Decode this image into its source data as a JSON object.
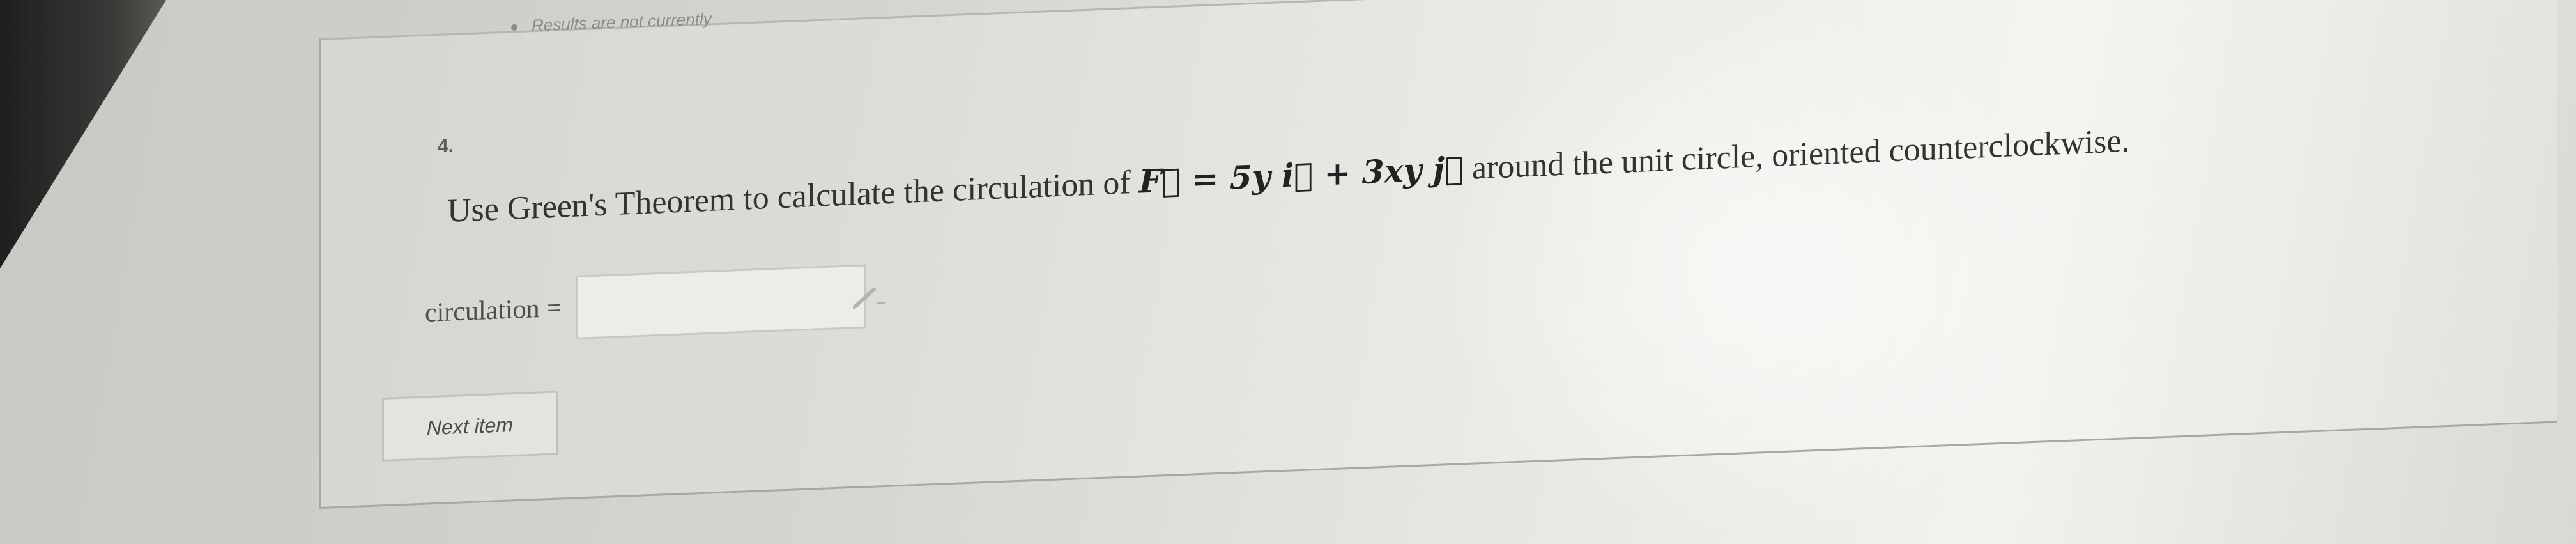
{
  "header": {
    "note": "Results are not currently"
  },
  "question": {
    "number": "4.",
    "text_before": "Use Green's Theorem to calculate the circulation of",
    "formula": "F⃗ = 5y i⃗ + 3xy j⃗",
    "text_after": "around the unit circle, oriented counterclockwise."
  },
  "answer": {
    "label": "circulation =",
    "value": "",
    "placeholder": ""
  },
  "buttons": {
    "next_item": "Next item"
  },
  "icons": {
    "pencil": "pencil-icon"
  },
  "colors": {
    "text": "#33332f",
    "input_border": "#c8c8c2"
  }
}
